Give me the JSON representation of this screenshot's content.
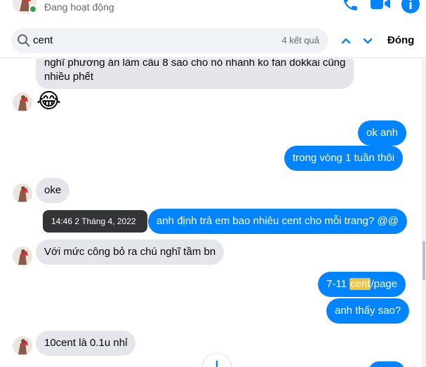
{
  "header": {
    "status": "Đang hoạt động",
    "icons": [
      "phone-icon",
      "video-icon",
      "info-icon"
    ]
  },
  "search": {
    "query": "cent",
    "result_count": "4 kết quả",
    "close_label": "Đóng"
  },
  "messages": {
    "m1": {
      "line1": "nghĩ phương án làm cầu 8 sao cho nó nhanh ko fan dokkai cũng",
      "line2": "nhiều phết"
    },
    "m2": {
      "emoji": "😂"
    },
    "m3": {
      "text": "ok anh"
    },
    "m4": {
      "text": "trong vòng 1 tuần thôi"
    },
    "m5": {
      "text": "oke"
    },
    "m6": {
      "text": "anh định trả em bao nhiêu cent cho mỗi trang? @@"
    },
    "m7": {
      "text": "Với mức công bỏ ra chú nghĩ tầm bn"
    },
    "m8": {
      "before": "7-11 ",
      "match": "cent",
      "after": "/page"
    },
    "m9": {
      "text": "anh thấy sao?"
    },
    "m10": {
      "text": "10cent là 0.1u nhỉ"
    }
  },
  "tooltip": {
    "timestamp": "14:46 2 Tháng 4, 2022"
  },
  "colors": {
    "outgoing": "#0084ff",
    "incoming": "#e4e6eb",
    "highlight": "#f5c33b",
    "online": "#31a24c"
  }
}
